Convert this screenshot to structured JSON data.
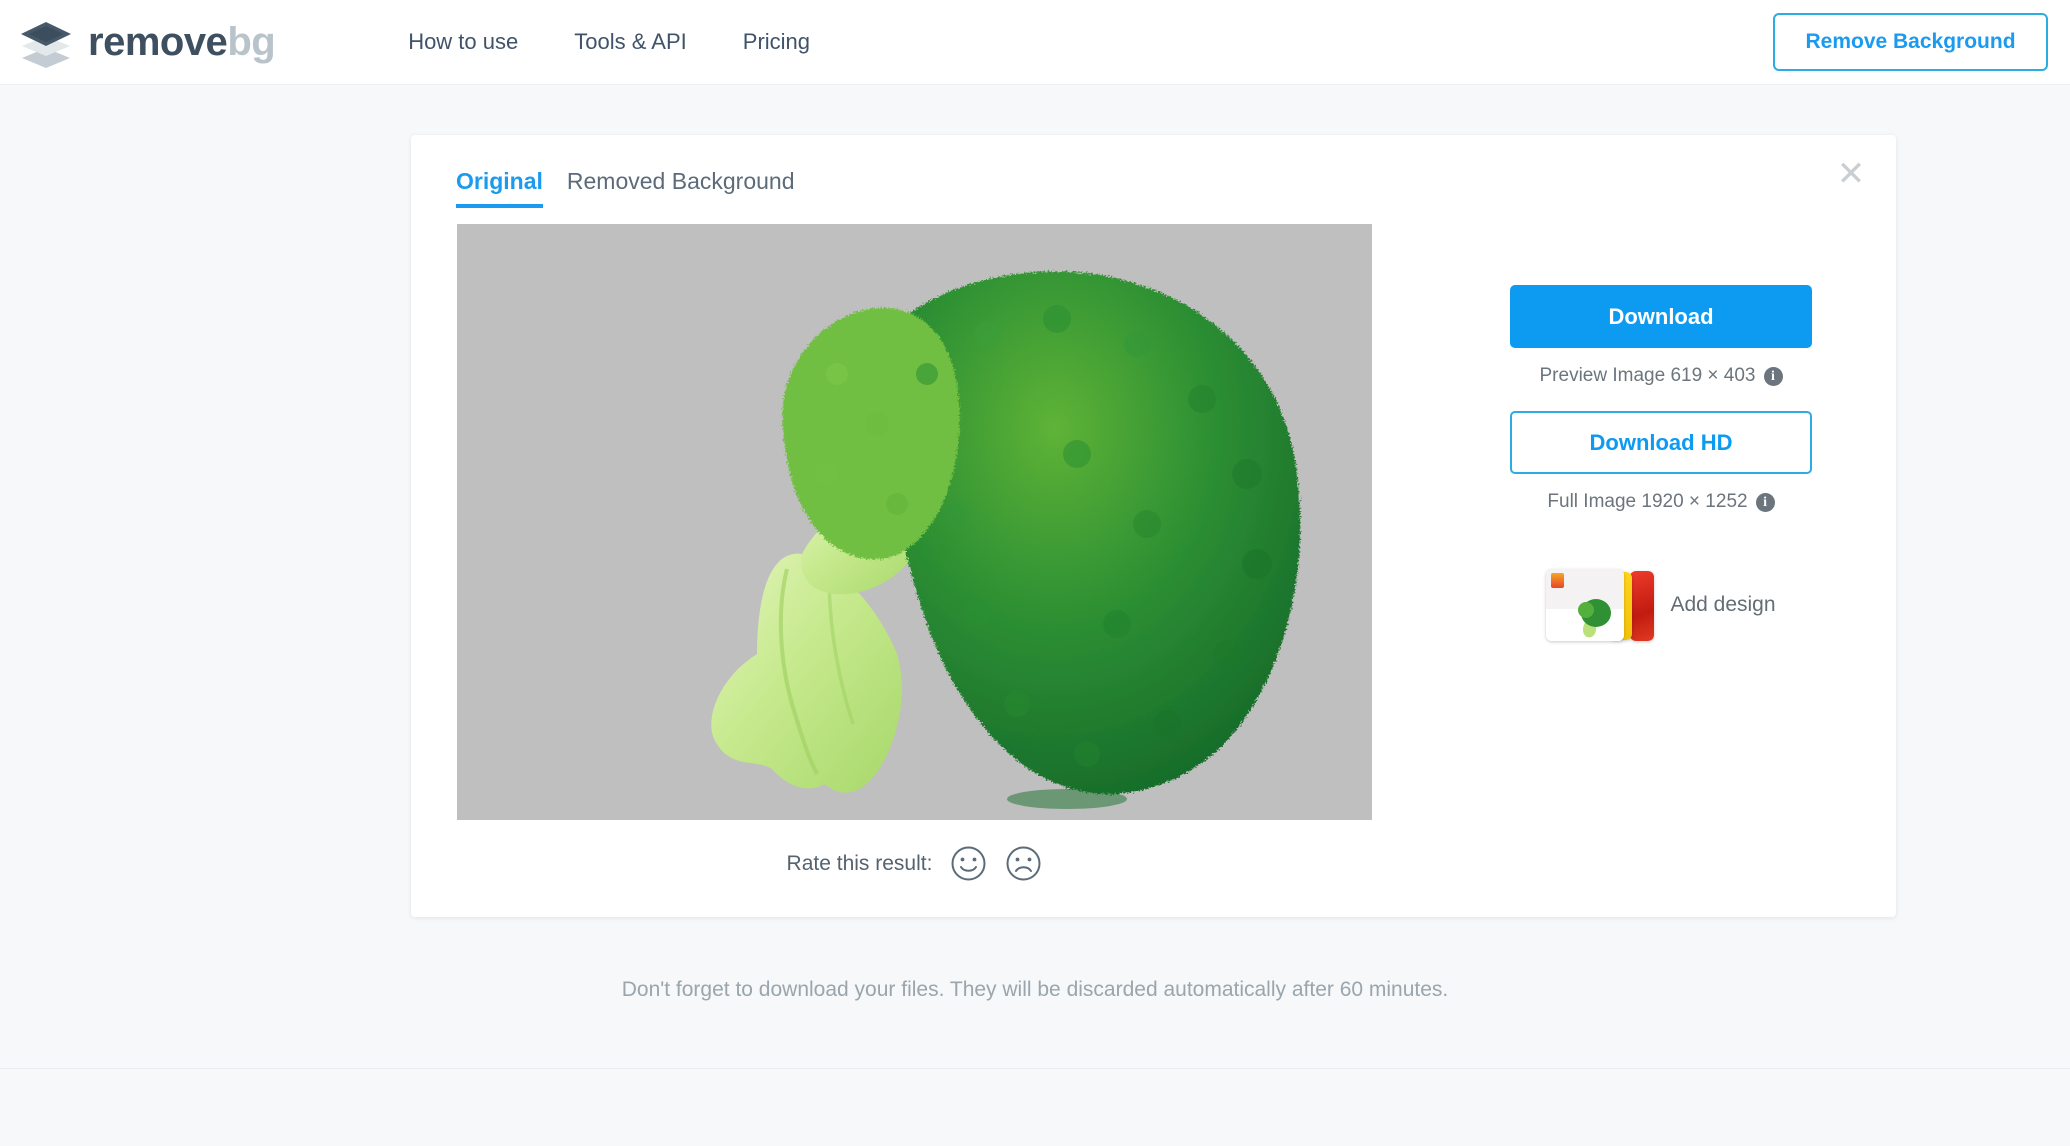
{
  "header": {
    "logo": {
      "icon": "layers-diamond-icon",
      "word1": "remove",
      "word2": "bg"
    },
    "nav": [
      {
        "label": "How to use",
        "name": "nav-how-to-use"
      },
      {
        "label": "Tools & API",
        "name": "nav-tools-api"
      },
      {
        "label": "Pricing",
        "name": "nav-pricing"
      }
    ],
    "cta_label": "Remove Background"
  },
  "card": {
    "close_icon": "close-icon",
    "tabs": [
      {
        "label": "Original",
        "active": true
      },
      {
        "label": "Removed Background",
        "active": false
      }
    ],
    "preview": {
      "alt": "broccoli-on-gray-background",
      "background_color": "#bfbfbf"
    },
    "actions": {
      "download_label": "Download",
      "preview_meta": "Preview Image 619 × 403",
      "download_hd_label": "Download HD",
      "full_meta": "Full Image 1920 × 1252",
      "info_icon_char": "i",
      "add_design_label": "Add design"
    },
    "rate": {
      "label": "Rate this result:",
      "positive_icon": "smiley-face-icon",
      "negative_icon": "sad-face-icon"
    }
  },
  "footer": {
    "note": "Don't forget to download your files. They will be discarded automatically after 60 minutes."
  },
  "colors": {
    "accent_blue": "#0d9bf2",
    "border_blue": "#2cace2",
    "logo_dark": "#3e5060",
    "logo_light": "#b9c3ca",
    "page_bg": "#f6f8f9"
  }
}
